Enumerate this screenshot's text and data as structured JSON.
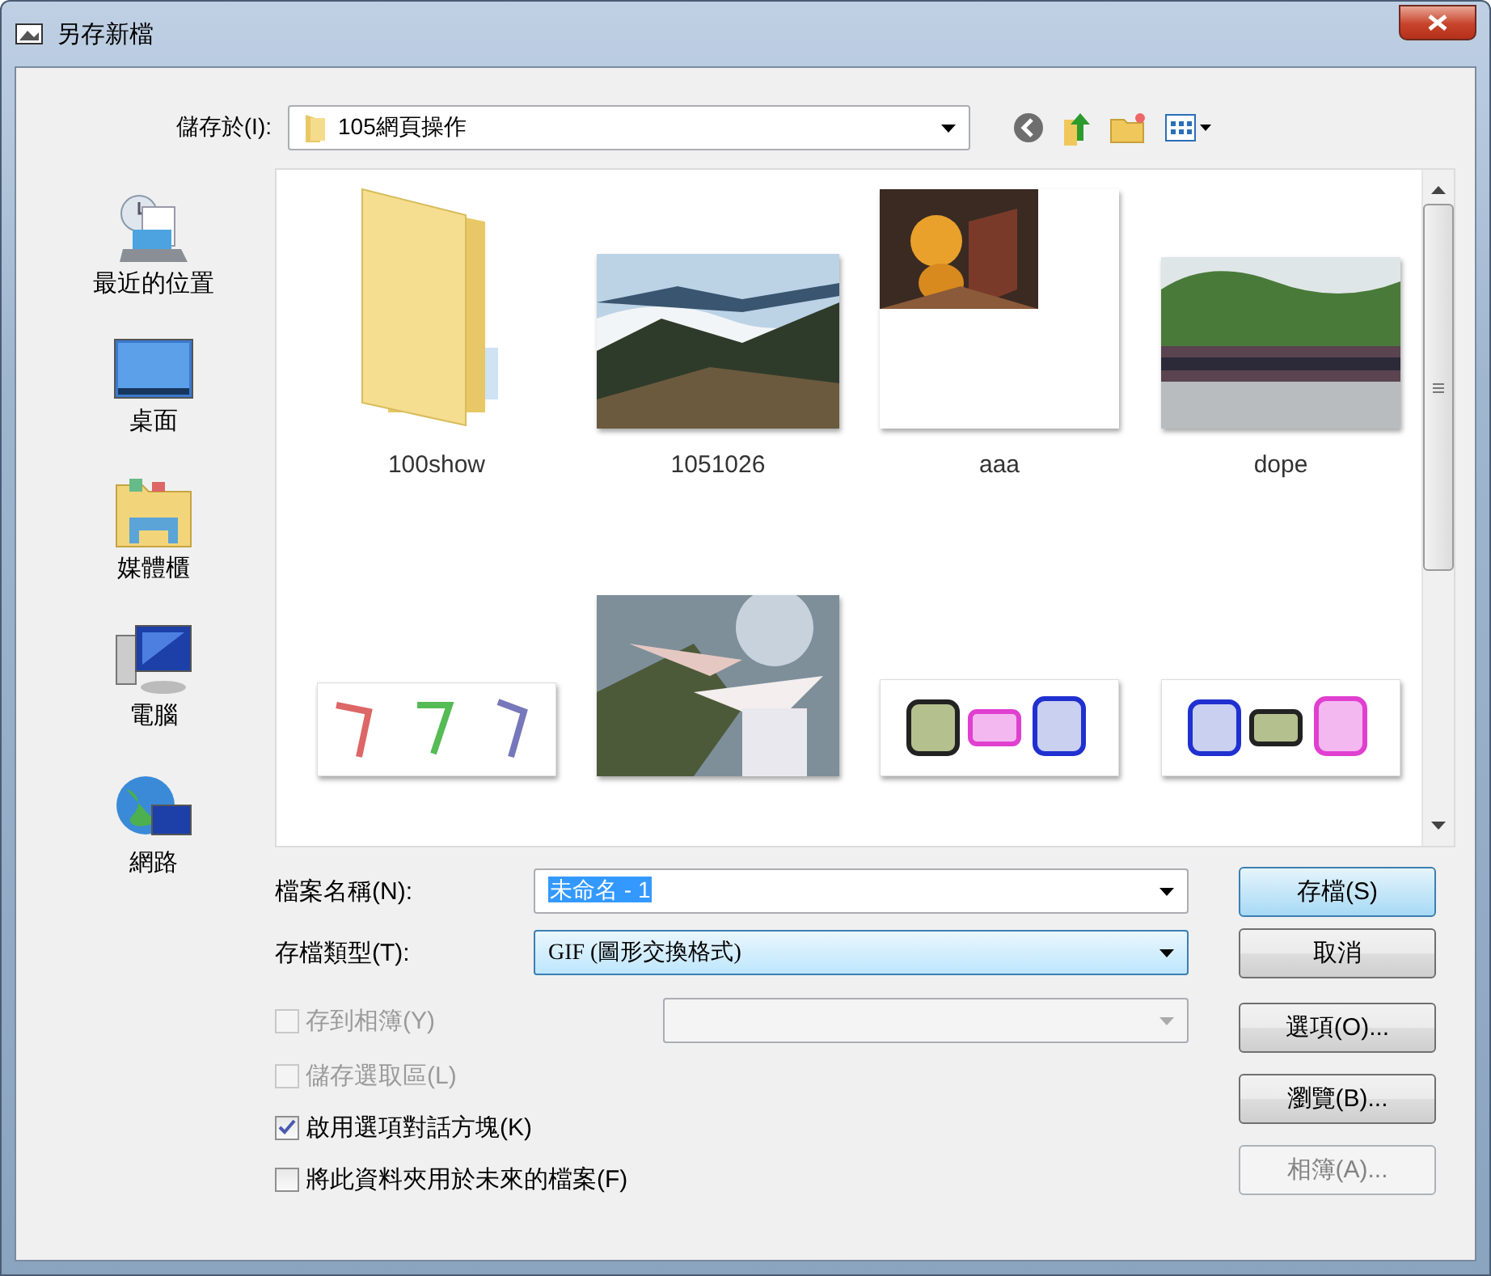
{
  "window": {
    "title": "另存新檔"
  },
  "location": {
    "label": "儲存於(I):",
    "folder": "105網頁操作"
  },
  "sidebar": {
    "items": [
      {
        "label": "最近的位置",
        "kind": "recent"
      },
      {
        "label": "桌面",
        "kind": "desktop"
      },
      {
        "label": "媒體櫃",
        "kind": "library"
      },
      {
        "label": "電腦",
        "kind": "computer"
      },
      {
        "label": "網路",
        "kind": "network"
      }
    ]
  },
  "files": [
    {
      "name": "100show",
      "kind": "folder"
    },
    {
      "name": "1051026",
      "kind": "picture"
    },
    {
      "name": "aaa",
      "kind": "picture"
    },
    {
      "name": "dope",
      "kind": "picture"
    },
    {
      "kind": "picture"
    },
    {
      "kind": "picture"
    },
    {
      "kind": "picture"
    },
    {
      "kind": "picture"
    }
  ],
  "form": {
    "filename": {
      "label": "檔案名稱(N):",
      "value": "未命名 - 1",
      "value_selected": true
    },
    "filetype": {
      "label": "存檔類型(T):",
      "value": "GIF (圖形交換格式)"
    },
    "album": {
      "label": "存到相簿(Y)",
      "checked": false,
      "disabled": true
    },
    "options": [
      {
        "label": "儲存選取區(L)",
        "checked": false,
        "disabled": true
      },
      {
        "label": "啟用選項對話方塊(K)",
        "checked": true,
        "disabled": false
      },
      {
        "label": "將此資料夾用於未來的檔案(F)",
        "checked": false,
        "disabled": false
      }
    ]
  },
  "buttons": [
    {
      "label": "存檔(S)",
      "default": true,
      "disabled": false
    },
    {
      "label": "取消",
      "default": false,
      "disabled": false
    },
    {
      "label": "選項(O)...",
      "default": false,
      "disabled": false
    },
    {
      "label": "瀏覽(B)...",
      "default": false,
      "disabled": false
    },
    {
      "label": "相簿(A)...",
      "default": false,
      "disabled": true
    }
  ]
}
